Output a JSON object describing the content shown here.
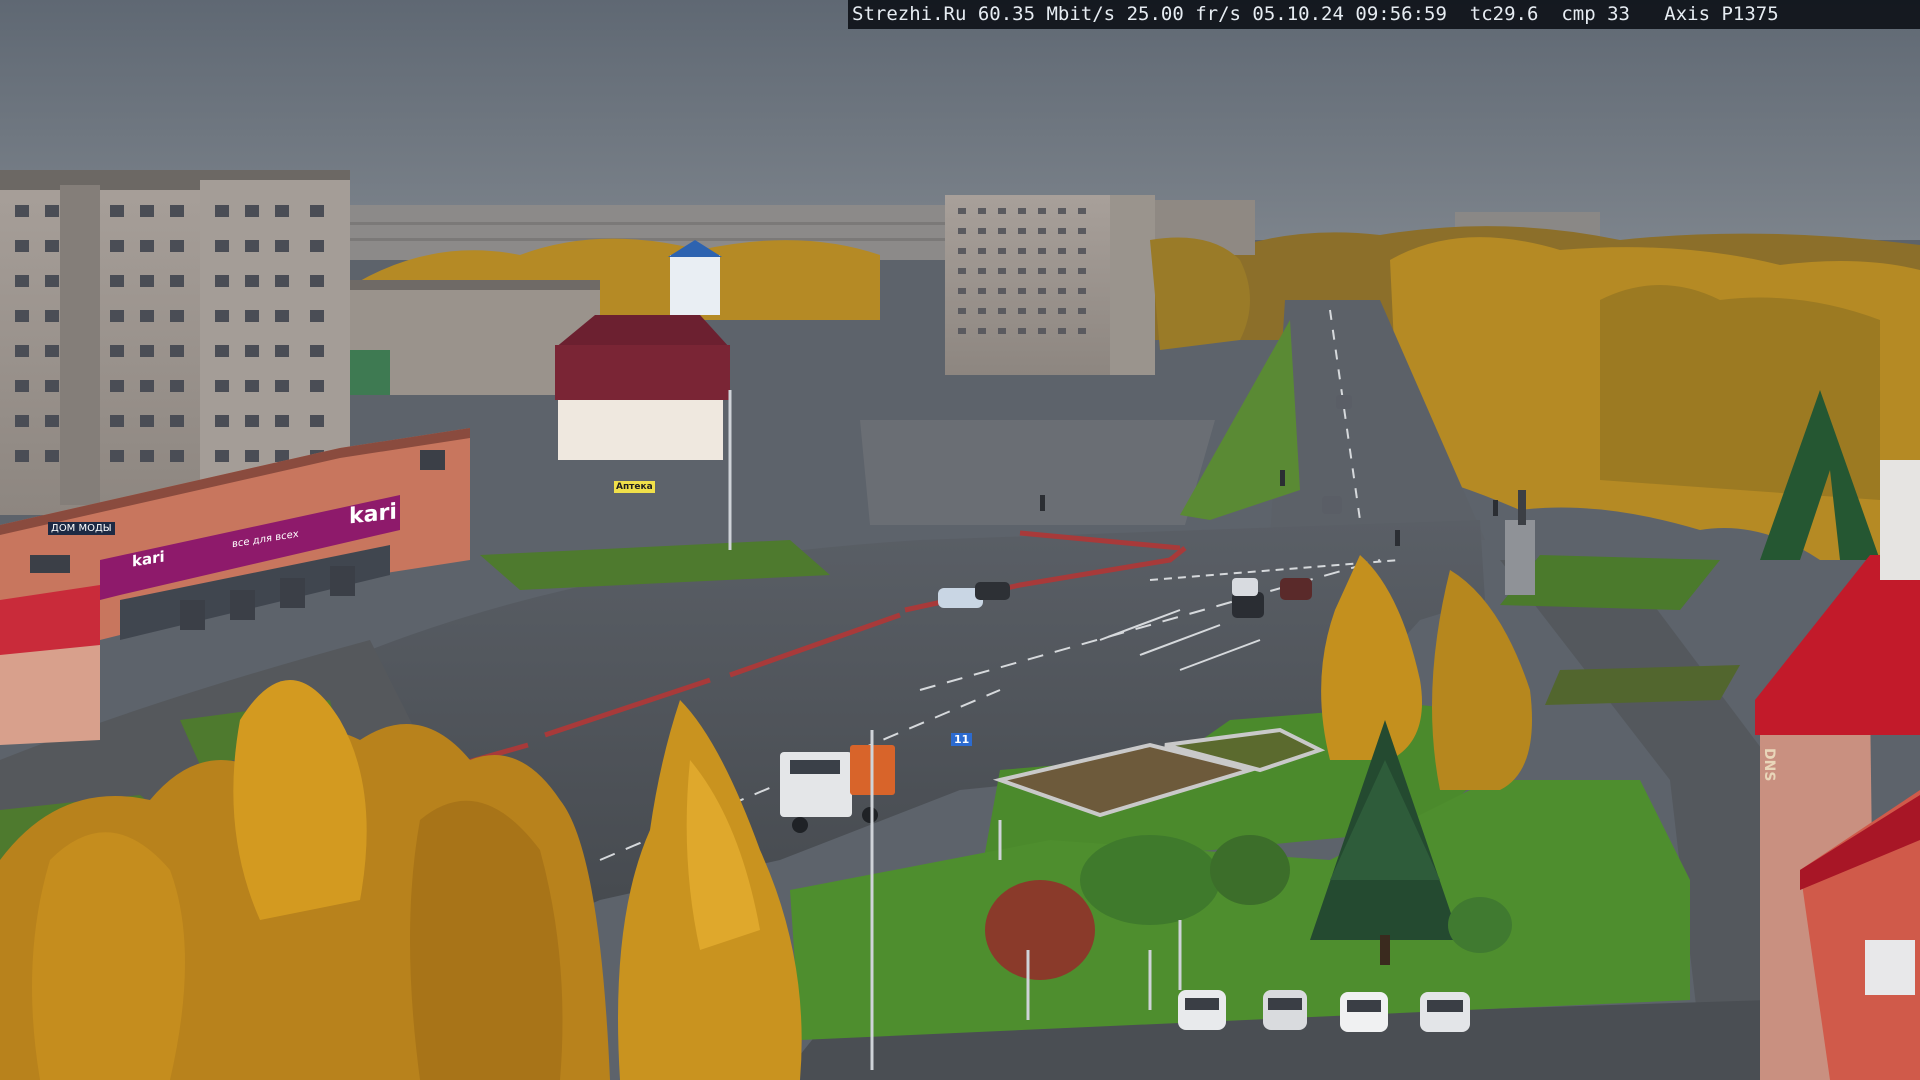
{
  "camera_overlay": {
    "site": "Strezhi.Ru",
    "bitrate": "60.35 Mbit/s",
    "frame_rate": "25.00 fr/s",
    "date": "05.10.24",
    "time": "09:56:59",
    "tc": "tc29.6",
    "cmp": "cmp 33",
    "camera_model": "Axis P1375"
  },
  "storefront_signs": {
    "kari_roof": "kari",
    "kari_banner": "kari",
    "kari_tagline": "все для всех",
    "store_plate": "ДОМ МОДЫ",
    "pharmacy": "Аптека",
    "route_sign": "11",
    "dns_sign": "DNS"
  },
  "palette": {
    "sky": "#6b7480",
    "asphalt": "#4f5358",
    "foliage_gold": "#c8941c",
    "grass": "#4e8a2e",
    "kari_magenta": "#8e1a6b",
    "roof_red": "#c21a2a"
  }
}
